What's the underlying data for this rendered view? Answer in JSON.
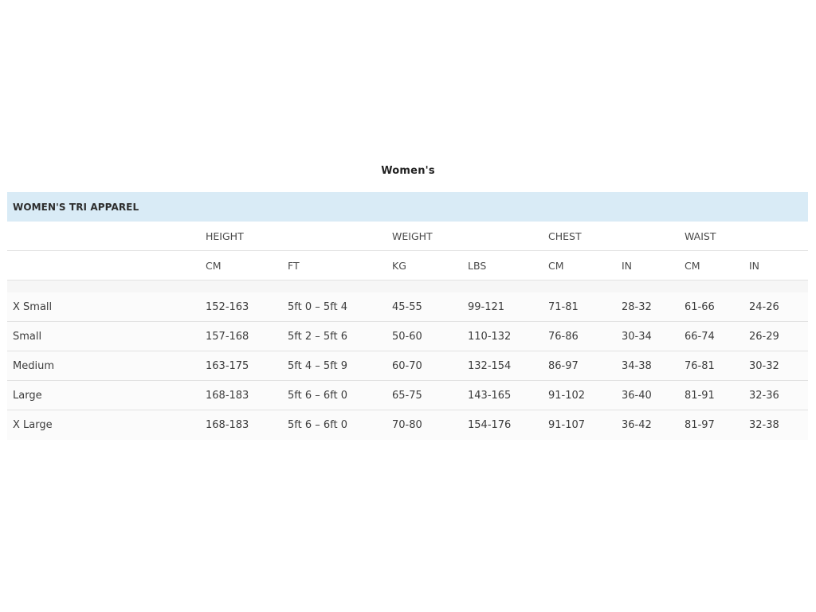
{
  "heading": "Women's",
  "table": {
    "title": "WOMEN'S TRI APPAREL",
    "groups": [
      "HEIGHT",
      "WEIGHT",
      "CHEST",
      "WAIST"
    ],
    "units": [
      "CM",
      "FT",
      "KG",
      "LBS",
      "CM",
      "IN",
      "CM",
      "IN"
    ],
    "rows": [
      {
        "size": "X Small",
        "cells": [
          "152-163",
          "5ft 0 – 5ft 4",
          "45-55",
          "99-121",
          "71-81",
          "28-32",
          "61-66",
          "24-26"
        ]
      },
      {
        "size": "Small",
        "cells": [
          "157-168",
          "5ft 2 – 5ft 6",
          "50-60",
          "110-132",
          "76-86",
          "30-34",
          "66-74",
          "26-29"
        ]
      },
      {
        "size": "Medium",
        "cells": [
          "163-175",
          "5ft 4 – 5ft 9",
          "60-70",
          "132-154",
          "86-97",
          "34-38",
          "76-81",
          "30-32"
        ]
      },
      {
        "size": "Large",
        "cells": [
          "168-183",
          "5ft 6 – 6ft 0",
          "65-75",
          "143-165",
          "91-102",
          "36-40",
          "81-91",
          "32-36"
        ]
      },
      {
        "size": "X Large",
        "cells": [
          "168-183",
          "5ft 6 – 6ft 0",
          "70-80",
          "154-176",
          "91-107",
          "36-42",
          "81-97",
          "32-38"
        ]
      }
    ]
  }
}
